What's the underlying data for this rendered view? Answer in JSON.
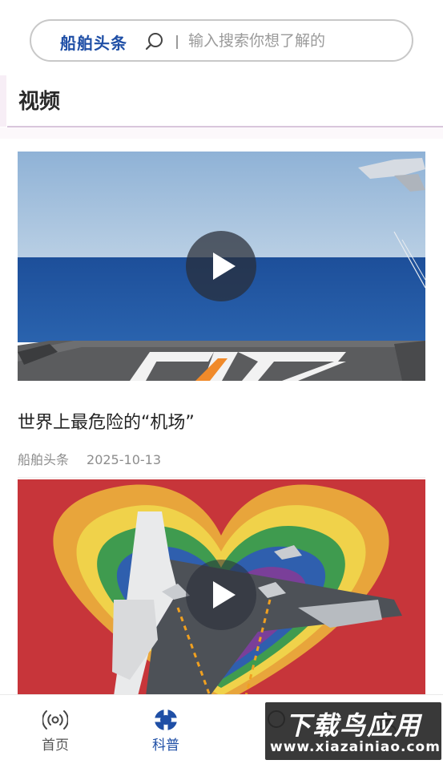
{
  "search": {
    "brand": "船舶头条",
    "placeholder": "输入搜索你想了解的"
  },
  "section": {
    "title": "视频"
  },
  "videos": [
    {
      "title": "世界上最危险的“机场”",
      "source": "船舶头条",
      "date": "2025-10-13"
    },
    {
      "title": "",
      "source": "",
      "date": ""
    }
  ],
  "tabbar": {
    "tabs": [
      {
        "label": "首页",
        "icon": "broadcast-icon",
        "active": false
      },
      {
        "label": "科普",
        "icon": "science-icon",
        "active": true
      },
      {
        "label": "",
        "icon": "tab3-icon",
        "active": false
      },
      {
        "label": "",
        "icon": "tab4-icon",
        "active": false
      }
    ]
  },
  "watermark": {
    "title": "下载鸟应用",
    "url": "www.xiazainiao.com"
  },
  "colors": {
    "brand": "#1f4fa6",
    "accent_line": "#d9c6dc"
  }
}
